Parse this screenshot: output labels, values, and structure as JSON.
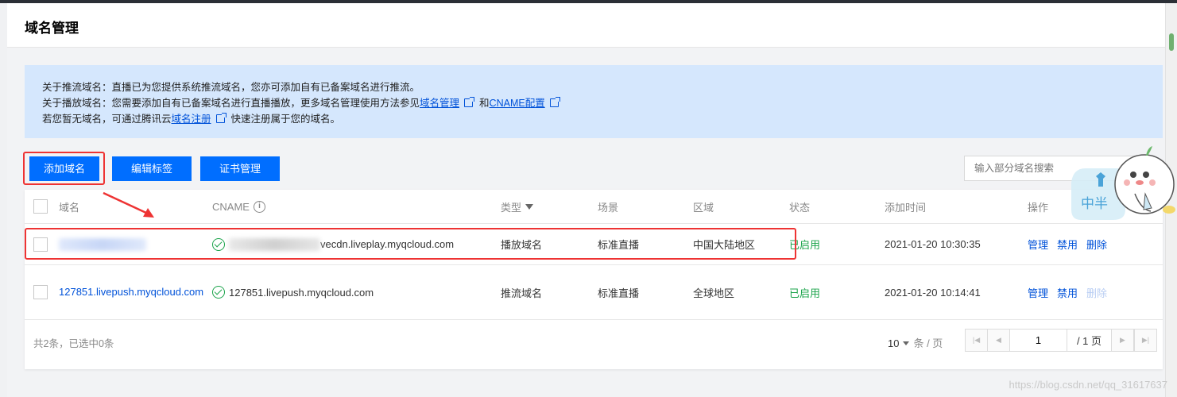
{
  "header": {
    "title": "域名管理"
  },
  "notice": {
    "line1": "关于推流域名：直播已为您提供系统推流域名，您亦可添加自有已备案域名进行推流。",
    "line2_prefix": "关于播放域名：您需要添加自有已备案域名进行直播播放，更多域名管理使用方法参见",
    "line2_link1": "域名管理",
    "line2_and": "和",
    "line2_link2": "CNAME配置",
    "line3_prefix": "若您暂无域名，可通过腾讯云",
    "line3_link": "域名注册",
    "line3_suffix": "快速注册属于您的域名。"
  },
  "toolbar": {
    "add_label": "添加域名",
    "tags_label": "编辑标签",
    "cert_label": "证书管理",
    "search_placeholder": "输入部分域名搜索"
  },
  "table": {
    "columns": {
      "domain": "域名",
      "cname": "CNAME",
      "type": "类型",
      "scene": "场景",
      "region": "区域",
      "status": "状态",
      "time": "添加时间",
      "ops": "操作"
    },
    "rows": [
      {
        "domain": "",
        "cname": "vecdn.liveplay.myqcloud.com",
        "type": "播放域名",
        "scene": "标准直播",
        "region": "中国大陆地区",
        "status": "已启用",
        "time": "2021-01-20 10:30:35",
        "ops": [
          "管理",
          "禁用",
          "删除"
        ]
      },
      {
        "domain": "127851.livepush.myqcloud.com",
        "cname": "127851.livepush.myqcloud.com",
        "type": "推流域名",
        "scene": "标准直播",
        "region": "全球地区",
        "status": "已启用",
        "time": "2021-01-20 10:14:41",
        "ops": [
          "管理",
          "禁用",
          "删除"
        ]
      }
    ]
  },
  "footer": {
    "summary": "共2条，已选中0条",
    "page_size": "10",
    "page_size_unit": "条 / 页",
    "current_page": "1",
    "total_pages": "/ 1 页"
  },
  "sticker": {
    "text": "中半"
  },
  "watermark": "https://blog.csdn.net/qq_31617637",
  "colors": {
    "primary": "#006eff",
    "notice_bg": "#d5e7fd",
    "enabled": "#1aa34a",
    "annotation": "#e33333"
  }
}
